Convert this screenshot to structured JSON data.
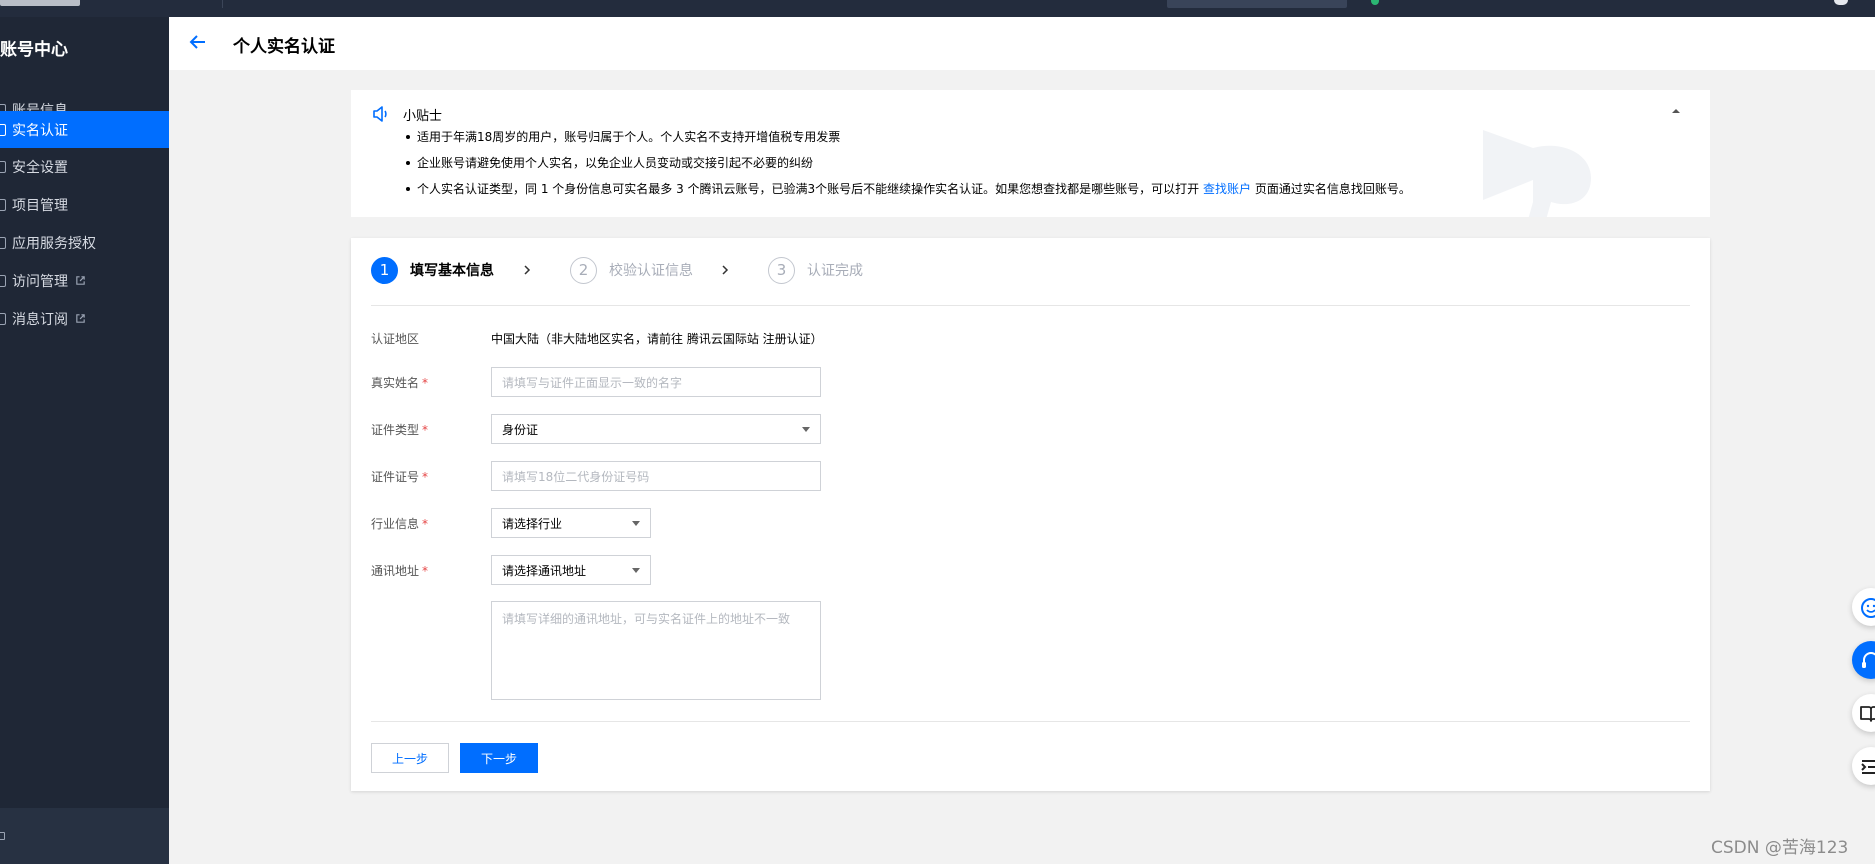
{
  "sidebar": {
    "title": "账号中心",
    "items": [
      {
        "label": "账号信息",
        "external": false,
        "active": false
      },
      {
        "label": "实名认证",
        "external": false,
        "active": true
      },
      {
        "label": "安全设置",
        "external": false,
        "active": false
      },
      {
        "label": "项目管理",
        "external": false,
        "active": false
      },
      {
        "label": "应用服务授权",
        "external": false,
        "active": false
      },
      {
        "label": "访问管理",
        "external": true,
        "active": false
      },
      {
        "label": "消息订阅",
        "external": true,
        "active": false
      }
    ]
  },
  "header": {
    "title": "个人实名认证"
  },
  "tips": {
    "title": "小贴士",
    "items": [
      "适用于年满18周岁的用户，账号归属于个人。个人实名不支持开增值税专用发票",
      "企业账号请避免使用个人实名，以免企业人员变动或交接引起不必要的纠纷"
    ],
    "item3_prefix": "个人实名认证类型，同 1 个身份信息可实名最多 3 个腾讯云账号，已验满3个账号后不能继续操作实名认证。如果您想查找都是哪些账号，可以打开",
    "item3_link": "查找账户",
    "item3_suffix": "页面通过实名信息找回账号。"
  },
  "steps": [
    {
      "num": "1",
      "label": "填写基本信息",
      "current": true
    },
    {
      "num": "2",
      "label": "校验认证信息",
      "current": false
    },
    {
      "num": "3",
      "label": "认证完成",
      "current": false
    }
  ],
  "form": {
    "region_label": "认证地区",
    "region_value": "中国大陆（非大陆地区实名，请前往 腾讯云国际站 注册认证）",
    "name_label": "真实姓名",
    "name_placeholder": "请填写与证件正面显示一致的名字",
    "idtype_label": "证件类型",
    "idtype_value": "身份证",
    "idno_label": "证件证号",
    "idno_placeholder": "请填写18位二代身份证号码",
    "industry_label": "行业信息",
    "industry_value": "请选择行业",
    "address_label": "通讯地址",
    "address_value": "请选择通讯地址",
    "address_detail_placeholder": "请填写详细的通讯地址，可与实名证件上的地址不一致",
    "required_mark": "*"
  },
  "buttons": {
    "prev": "上一步",
    "next": "下一步"
  },
  "watermark": "CSDN @苦海123",
  "colors": {
    "primary": "#006eff",
    "sidebar_bg": "#1f2736",
    "required": "#e54545"
  }
}
